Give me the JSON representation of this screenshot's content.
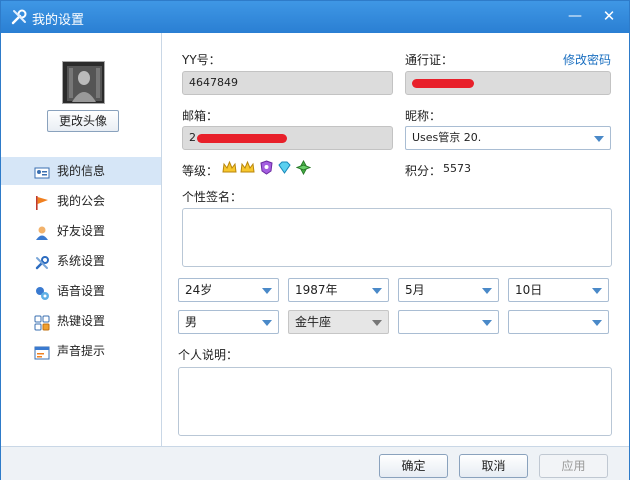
{
  "window": {
    "title": "我的设置",
    "minimize_glyph": "—",
    "close_glyph": "✕"
  },
  "sidebar": {
    "avatar_button": "更改头像",
    "items": [
      {
        "label": "我的信息",
        "icon": "user-card-icon",
        "active": true
      },
      {
        "label": "我的公会",
        "icon": "flag-icon",
        "active": false
      },
      {
        "label": "好友设置",
        "icon": "friend-icon",
        "active": false
      },
      {
        "label": "系统设置",
        "icon": "tools-icon",
        "active": false
      },
      {
        "label": "语音设置",
        "icon": "voice-icon",
        "active": false
      },
      {
        "label": "热键设置",
        "icon": "hotkey-icon",
        "active": false
      },
      {
        "label": "声音提示",
        "icon": "sound-window-icon",
        "active": false
      }
    ]
  },
  "form": {
    "yy_label": "YY号：",
    "yy_value": "4647849",
    "passport_label": "通行证：",
    "change_password": "修改密码",
    "email_label": "邮箱：",
    "email_value_prefix": "2",
    "nickname_label": "昵称：",
    "nickname_value": "Uses管京   20.",
    "level_label": "等级：",
    "points_label": "积分：",
    "points_value": "5573",
    "signature_label": "个性签名：",
    "age": "24岁",
    "birth_year": "1987年",
    "birth_month": "5月",
    "birth_day": "10日",
    "gender": "男",
    "zodiac": "金牛座",
    "extra1": "",
    "extra2": "",
    "about_label": "个人说明："
  },
  "footer": {
    "ok": "确定",
    "cancel": "取消",
    "apply": "应用"
  },
  "colors": {
    "titlebar": "#2a7fd3",
    "redaction": "#e8202a",
    "link": "#1a6fc0",
    "active_nav": "#d6e6f7"
  }
}
